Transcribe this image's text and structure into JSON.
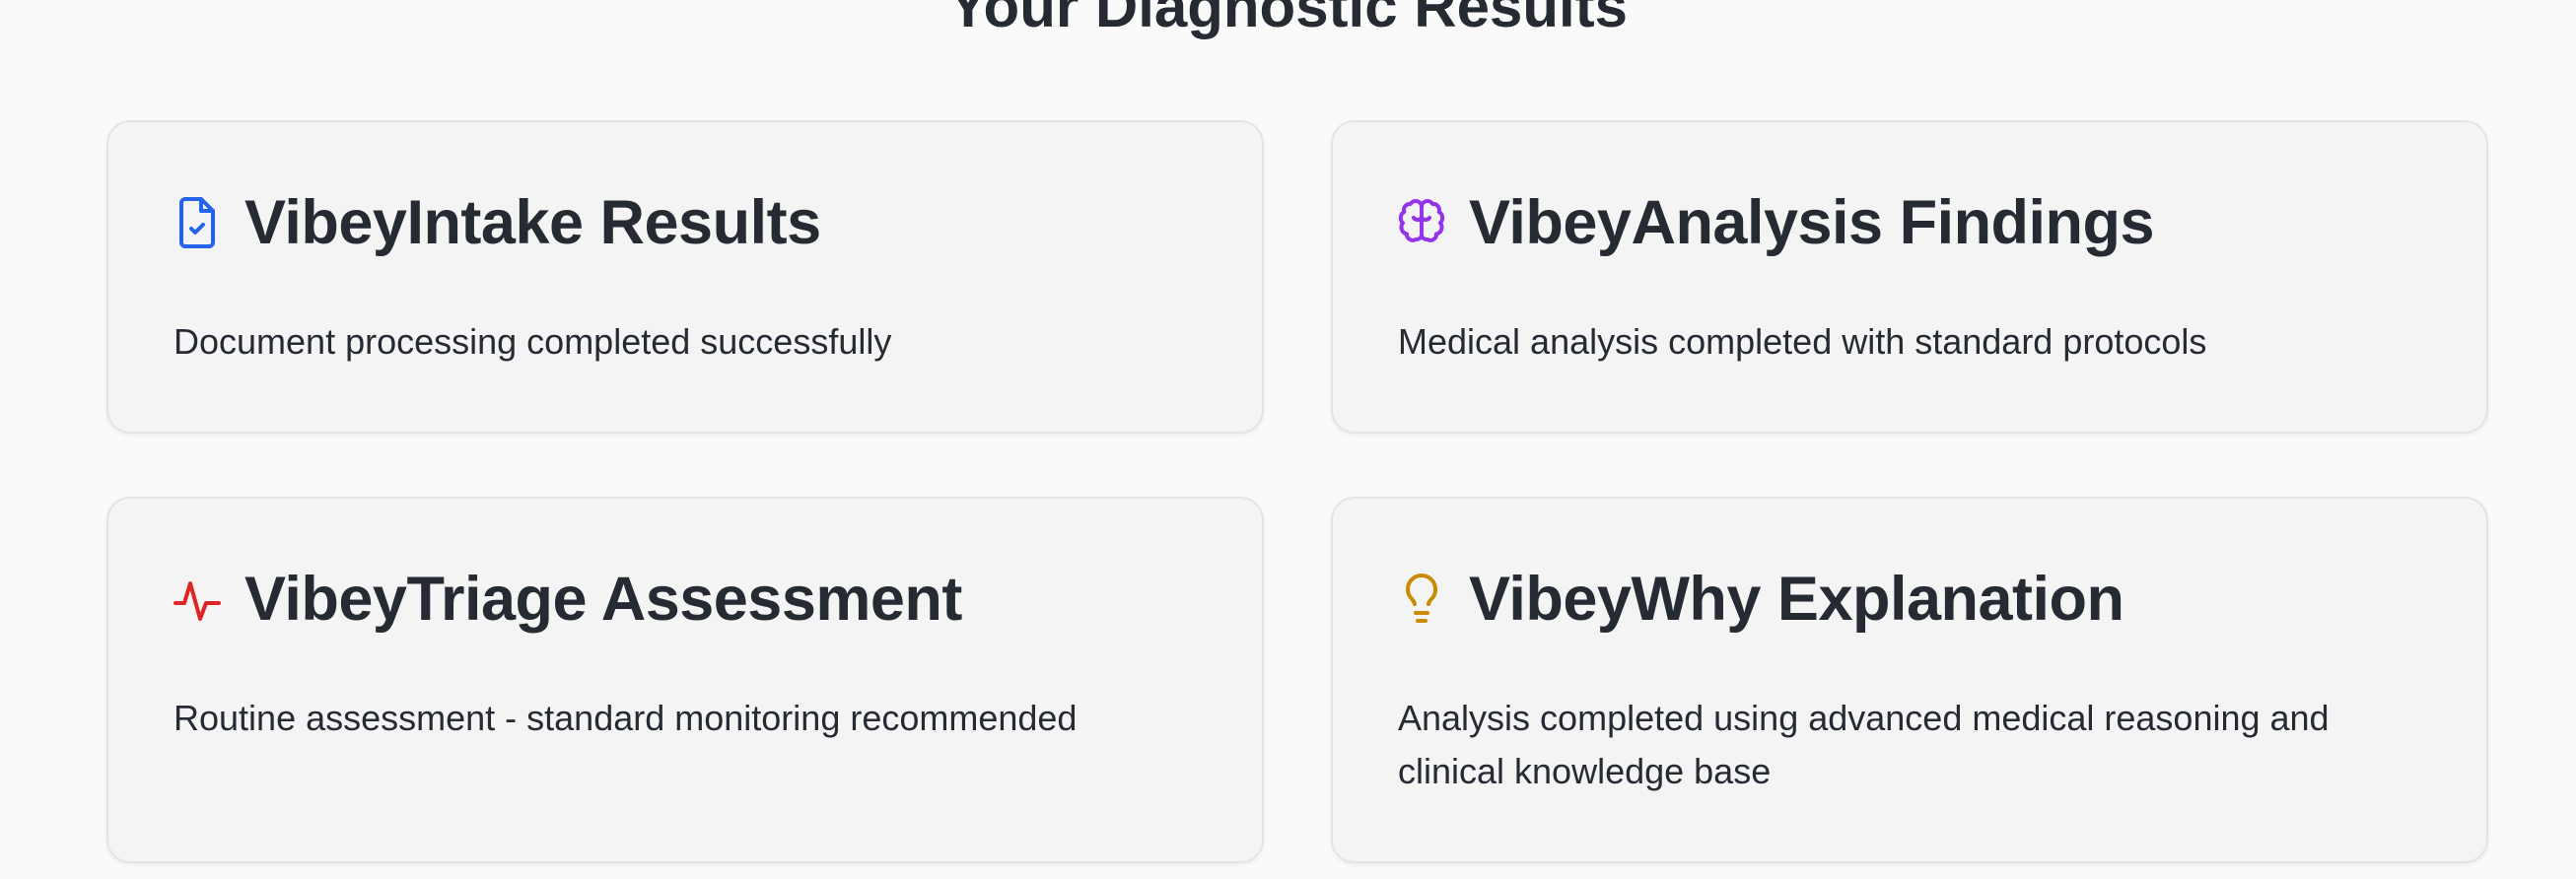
{
  "page": {
    "title": "Your Diagnostic Results"
  },
  "cards": [
    {
      "title": "VibeyIntake Results",
      "text": "Document processing completed successfully",
      "icon": "file-check-icon",
      "icon_color": "#2563eb"
    },
    {
      "title": "VibeyAnalysis Findings",
      "text": "Medical analysis completed with standard protocols",
      "icon": "brain-icon",
      "icon_color": "#9333ea"
    },
    {
      "title": "VibeyTriage Assessment",
      "text": "Routine assessment - standard monitoring recommended",
      "icon": "activity-icon",
      "icon_color": "#dc2626"
    },
    {
      "title": "VibeyWhy Explanation",
      "text": "Analysis completed using advanced medical reasoning and clinical knowledge base",
      "icon": "lightbulb-icon",
      "icon_color": "#ca8a04"
    }
  ]
}
